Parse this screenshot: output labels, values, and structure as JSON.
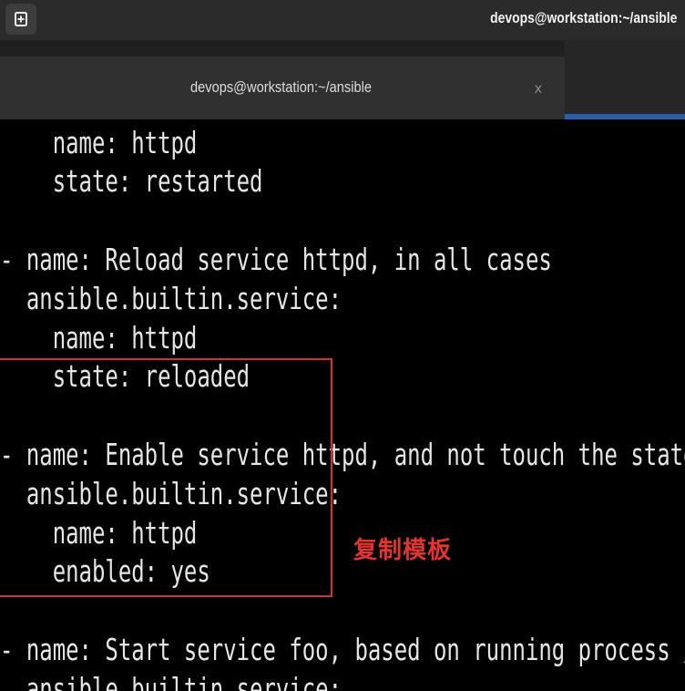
{
  "window": {
    "title": "devops@workstation:~/ansible",
    "new_tab_icon": "new-tab-icon"
  },
  "tabs": [
    {
      "label": "devops@workstation:~/ansible",
      "close_label": "x"
    }
  ],
  "terminal": {
    "lines": [
      "    name: httpd",
      "    state: restarted",
      "",
      "- name: Reload service httpd, in all cases",
      "  ansible.builtin.service:",
      "    name: httpd",
      "    state: reloaded",
      "",
      "- name: Enable service httpd, and not touch the state",
      "  ansible.builtin.service:",
      "    name: httpd",
      "    enabled: yes",
      "",
      "- name: Start service foo, based on running process /usr/b",
      "  ansible.builtin.service:"
    ]
  },
  "annotation": {
    "text": "复制模板",
    "color": "#e3342f"
  },
  "colors": {
    "accent": "#2a5ea8",
    "highlight_border": "#d8302c"
  }
}
